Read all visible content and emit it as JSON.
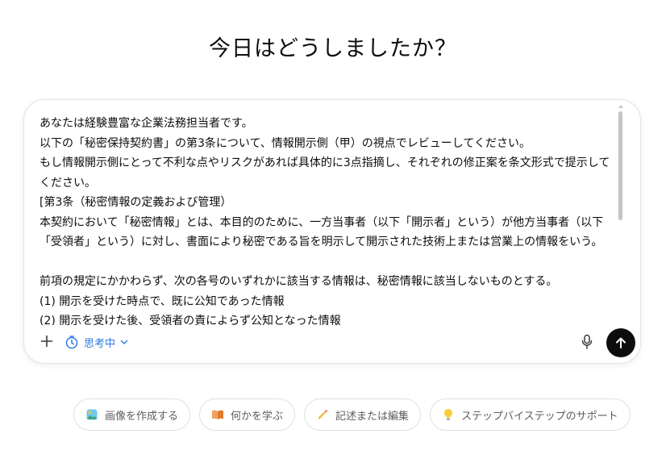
{
  "heading": "今日はどうしましたか？",
  "composer": {
    "prompt_lines": [
      "あなたは経験豊富な企業法務担当者です。",
      "以下の「秘密保持契約書」の第3条について、情報開示側（甲）の視点でレビューしてください。",
      "もし情報開示側にとって不利な点やリスクがあれば具体的に3点指摘し、それぞれの修正案を条文形式で提示してください。",
      "[第3条（秘密情報の定義および管理）",
      "本契約において「秘密情報」とは、本目的のために、一方当事者（以下「開示者」という）が他方当事者（以下「受領者」という）に対し、書面により秘密である旨を明示して開示された技術上または営業上の情報をいう。",
      "",
      "前項の規定にかかわらず、次の各号のいずれかに該当する情報は、秘密情報に該当しないものとする。",
      "(1) 開示を受けた時点で、既に公知であった情報",
      "(2) 開示を受けた後、受領者の責によらず公知となった情報"
    ],
    "think_label": "思考中",
    "icons": {
      "plus": "plus-icon",
      "think": "timer-icon",
      "dropdown": "chevron-down-icon",
      "mic": "microphone-icon",
      "send": "arrow-up-icon"
    },
    "accent_color": "#2f7ae5",
    "send_color": "#0d0d0d"
  },
  "suggestions": [
    {
      "label": "画像を作成する",
      "icon": "image-icon"
    },
    {
      "label": "何かを学ぶ",
      "icon": "book-icon"
    },
    {
      "label": "記述または編集",
      "icon": "pencil-icon"
    },
    {
      "label": "ステップバイステップのサポート",
      "icon": "lightbulb-icon"
    }
  ]
}
